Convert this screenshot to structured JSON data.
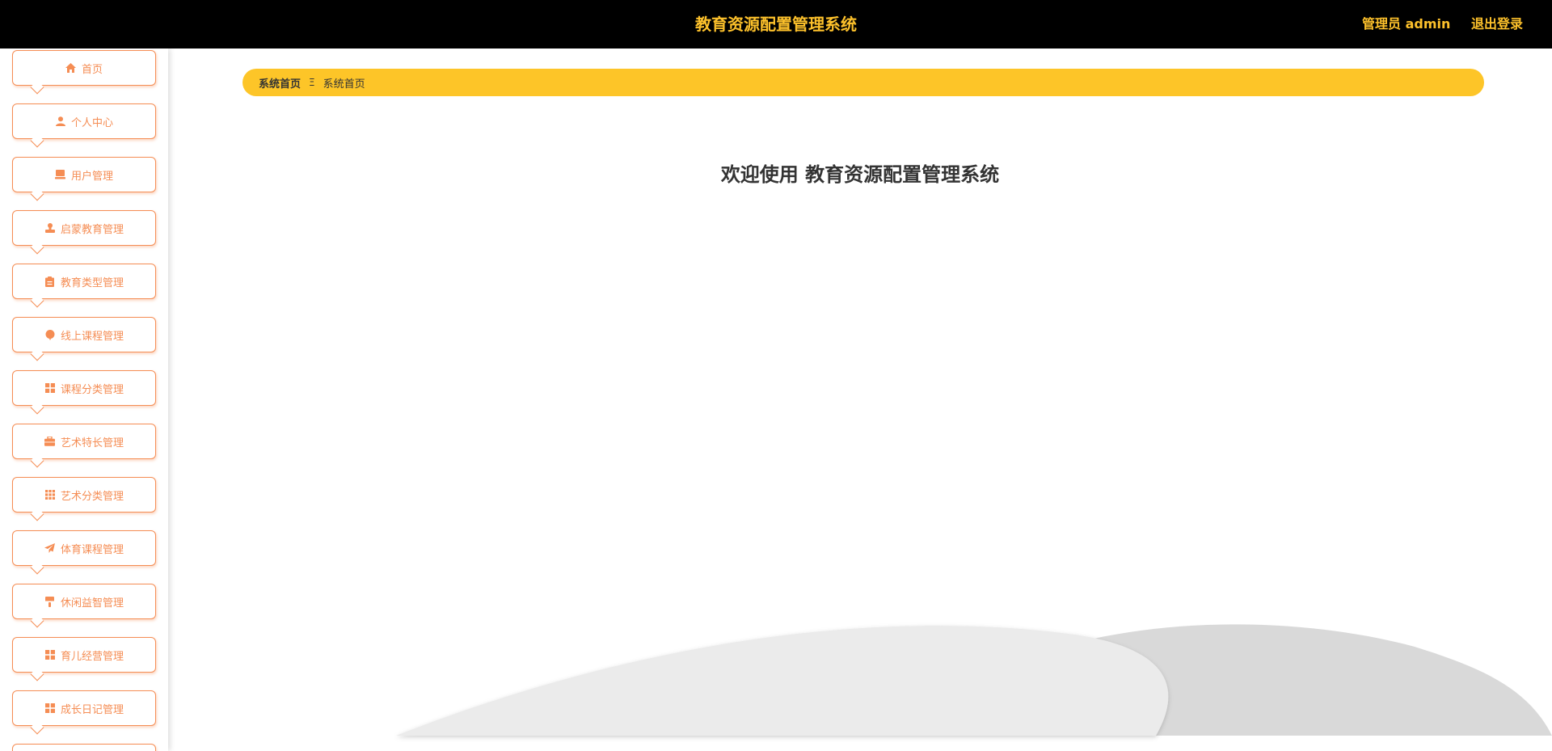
{
  "header": {
    "title": "教育资源配置管理系统",
    "user_label": "管理员 admin",
    "logout_label": "退出登录"
  },
  "sidebar": {
    "items": [
      {
        "label": "首页",
        "icon": "home-icon"
      },
      {
        "label": "个人中心",
        "icon": "user-icon"
      },
      {
        "label": "用户管理",
        "icon": "monitor-icon"
      },
      {
        "label": "启蒙教育管理",
        "icon": "stamp-icon"
      },
      {
        "label": "教育类型管理",
        "icon": "clipboard-icon"
      },
      {
        "label": "线上课程管理",
        "icon": "balloon-icon"
      },
      {
        "label": "课程分类管理",
        "icon": "grid-icon"
      },
      {
        "label": "艺术特长管理",
        "icon": "briefcase-icon"
      },
      {
        "label": "艺术分类管理",
        "icon": "grid-dots-icon"
      },
      {
        "label": "体育课程管理",
        "icon": "paper-plane-icon"
      },
      {
        "label": "休闲益智管理",
        "icon": "brush-icon"
      },
      {
        "label": "育儿经营管理",
        "icon": "grid-icon"
      },
      {
        "label": "成长日记管理",
        "icon": "grid-icon"
      }
    ]
  },
  "breadcrumb": {
    "home": "系统首页",
    "separator": "Ξ",
    "current": "系统首页"
  },
  "main": {
    "welcome": "欢迎使用 教育资源配置管理系统"
  },
  "colors": {
    "header_bg": "#000000",
    "accent_yellow": "#fdc12b",
    "menu_orange": "#f58d54"
  }
}
